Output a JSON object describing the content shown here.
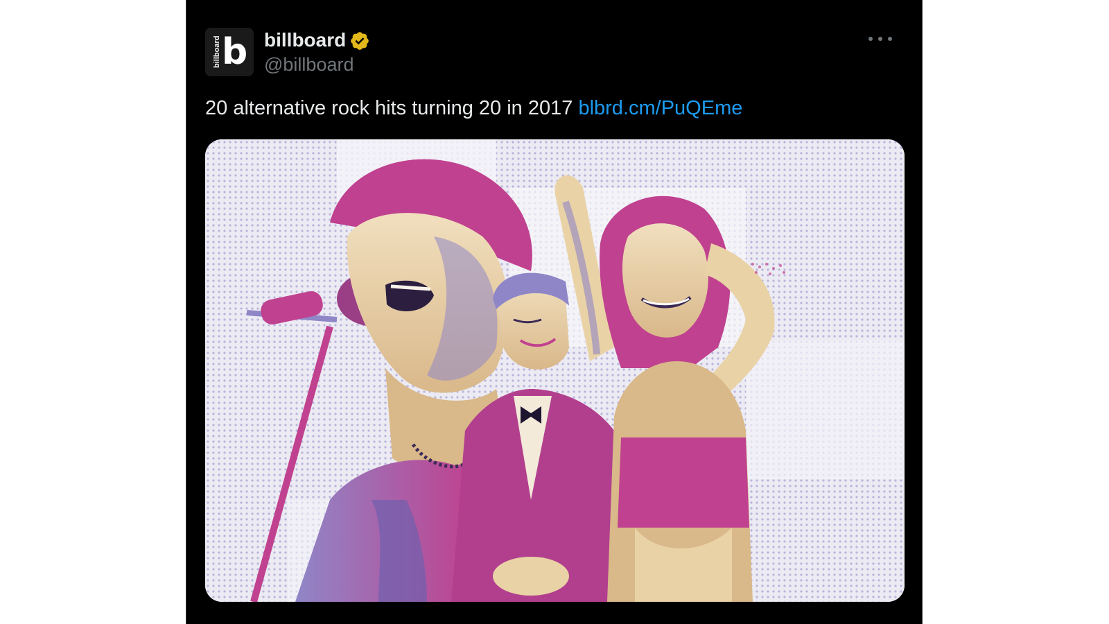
{
  "tweet": {
    "author": {
      "display_name": "billboard",
      "handle": "@billboard",
      "verified": true,
      "verified_badge_color": "#e2b719",
      "avatar": {
        "icon": "billboard-logo-icon",
        "letter": "b",
        "wordmark": "billboard"
      }
    },
    "more_icon": "more-horizontal-icon",
    "text": "20 alternative rock hits turning 20 in 2017",
    "link": "blbrd.cm/PuQEme",
    "media": {
      "icon": "photo-collage-image",
      "colors": {
        "magenta": "#c0418f",
        "lavender": "#8f86c7",
        "cream": "#e9d2a6",
        "background": "#ecebf3"
      }
    }
  },
  "colors": {
    "background": "#000000",
    "text_primary": "#e7e9ea",
    "text_secondary": "#71767b",
    "link": "#1d9bf0"
  }
}
